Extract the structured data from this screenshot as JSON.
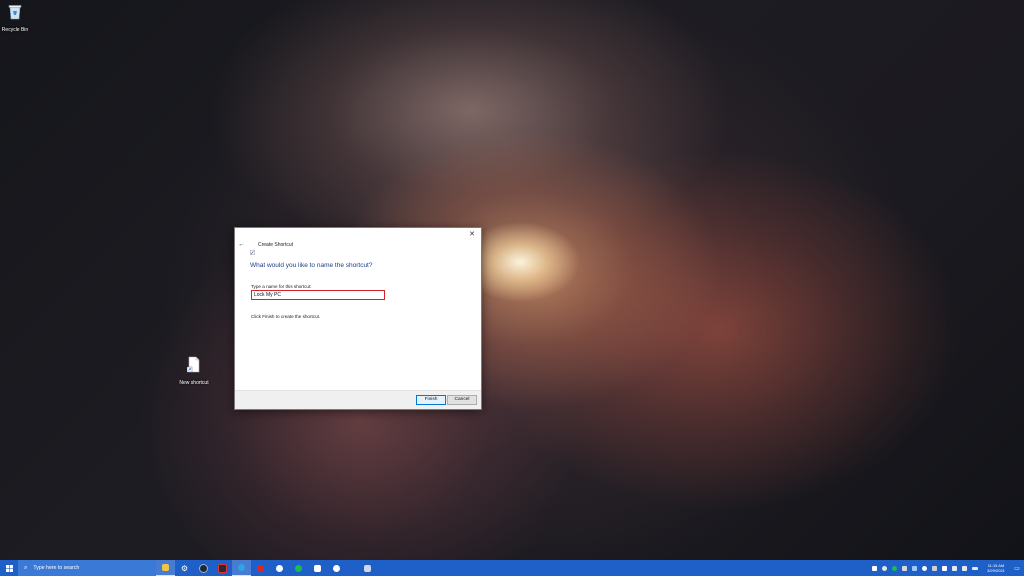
{
  "desktop": {
    "icons": [
      {
        "label": "Recycle Bin",
        "icon": "recycle-bin-icon"
      },
      {
        "label": "New shortcut",
        "icon": "shortcut-file-icon"
      }
    ]
  },
  "dialog": {
    "title": "Create Shortcut",
    "heading": "What would you like to name the shortcut?",
    "field_label": "Type a name for this shortcut:",
    "field_value": "Lock My PC",
    "instruction": "Click Finish to create the shortcut.",
    "buttons": {
      "finish": "Finish",
      "cancel": "Cancel"
    },
    "close_glyph": "✕",
    "back_glyph": "←"
  },
  "taskbar": {
    "search_placeholder": "Type here to search",
    "apps": [
      {
        "name": "file-explorer",
        "color": "#f4c542",
        "active": true
      },
      {
        "name": "settings",
        "color": "#ffffff",
        "active": false
      },
      {
        "name": "steam",
        "color": "#1b2838",
        "active": false
      },
      {
        "name": "app-4",
        "color": "#2a2a2a",
        "active": false
      },
      {
        "name": "edge",
        "color": "#2fa3e6",
        "active": true
      },
      {
        "name": "app-red",
        "color": "#d8262c",
        "active": false
      },
      {
        "name": "xbox",
        "color": "#ffffff",
        "active": false
      },
      {
        "name": "spotify",
        "color": "#1db954",
        "active": false
      },
      {
        "name": "store",
        "color": "#ffffff",
        "active": false
      },
      {
        "name": "messaging",
        "color": "#ffffff",
        "active": false
      },
      {
        "name": "app-11",
        "color": "#cfd8e6",
        "active": false
      }
    ],
    "clock_time": "11:15 AM",
    "clock_date": "3/29/2021"
  },
  "colors": {
    "taskbar": "#1f60c8",
    "heading": "#1e3f8a",
    "highlight_box": "#d3232a"
  }
}
